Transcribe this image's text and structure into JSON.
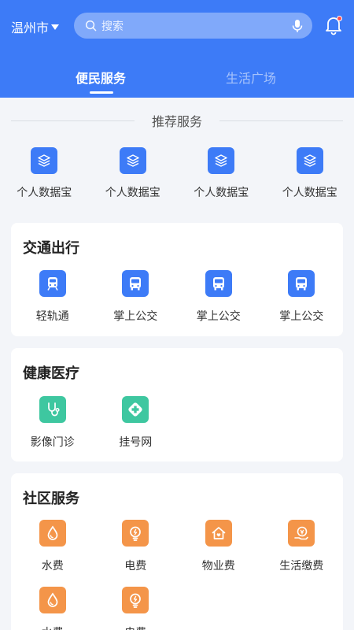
{
  "header": {
    "city": "温州市",
    "search_placeholder": "搜索",
    "tabs": [
      {
        "label": "便民服务",
        "active": true
      },
      {
        "label": "生活广场",
        "active": false
      }
    ],
    "brand_color": "#3d7bf7",
    "notification_dot": true
  },
  "recommended": {
    "title": "推荐服务",
    "items": [
      {
        "label": "个人数据宝",
        "icon": "layers-icon"
      },
      {
        "label": "个人数据宝",
        "icon": "layers-icon"
      },
      {
        "label": "个人数据宝",
        "icon": "layers-icon"
      },
      {
        "label": "个人数据宝",
        "icon": "layers-icon"
      }
    ]
  },
  "sections": [
    {
      "title": "交通出行",
      "color": "#3d7bf7",
      "items": [
        {
          "label": "轻轨通",
          "icon": "train-icon"
        },
        {
          "label": "掌上公交",
          "icon": "bus-icon"
        },
        {
          "label": "掌上公交",
          "icon": "bus-icon"
        },
        {
          "label": "掌上公交",
          "icon": "bus-icon"
        }
      ]
    },
    {
      "title": "健康医疗",
      "color": "#3ec7a0",
      "items": [
        {
          "label": "影像门诊",
          "icon": "stethoscope-icon"
        },
        {
          "label": "挂号网",
          "icon": "medical-cross-icon"
        }
      ]
    },
    {
      "title": "社区服务",
      "color": "#f49549",
      "items": [
        {
          "label": "水费",
          "icon": "water-drop-icon"
        },
        {
          "label": "电费",
          "icon": "lightbulb-icon"
        },
        {
          "label": "物业费",
          "icon": "house-icon"
        },
        {
          "label": "生活缴费",
          "icon": "payment-icon"
        },
        {
          "label": "水费",
          "icon": "water-drop-icon"
        },
        {
          "label": "电费",
          "icon": "lightbulb-icon"
        }
      ]
    }
  ]
}
